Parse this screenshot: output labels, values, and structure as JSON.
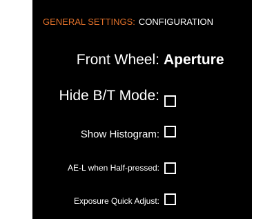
{
  "header": {
    "section": "GENERAL SETTINGS:",
    "page": "CONFIGURATION"
  },
  "settings": [
    {
      "label": "Front Wheel:",
      "value": "Aperture",
      "type": "value"
    },
    {
      "label": "Hide B/T Mode:",
      "checked": false,
      "type": "checkbox"
    },
    {
      "label": "Show Histogram:",
      "checked": false,
      "type": "checkbox"
    },
    {
      "label": "AE-L when Half-pressed:",
      "checked": false,
      "type": "checkbox"
    },
    {
      "label": "Exposure Quick Adjust:",
      "checked": false,
      "type": "checkbox"
    }
  ],
  "colors": {
    "panel_background": "#000000",
    "header_accent": "#e0702a",
    "text": "#ffffff"
  }
}
